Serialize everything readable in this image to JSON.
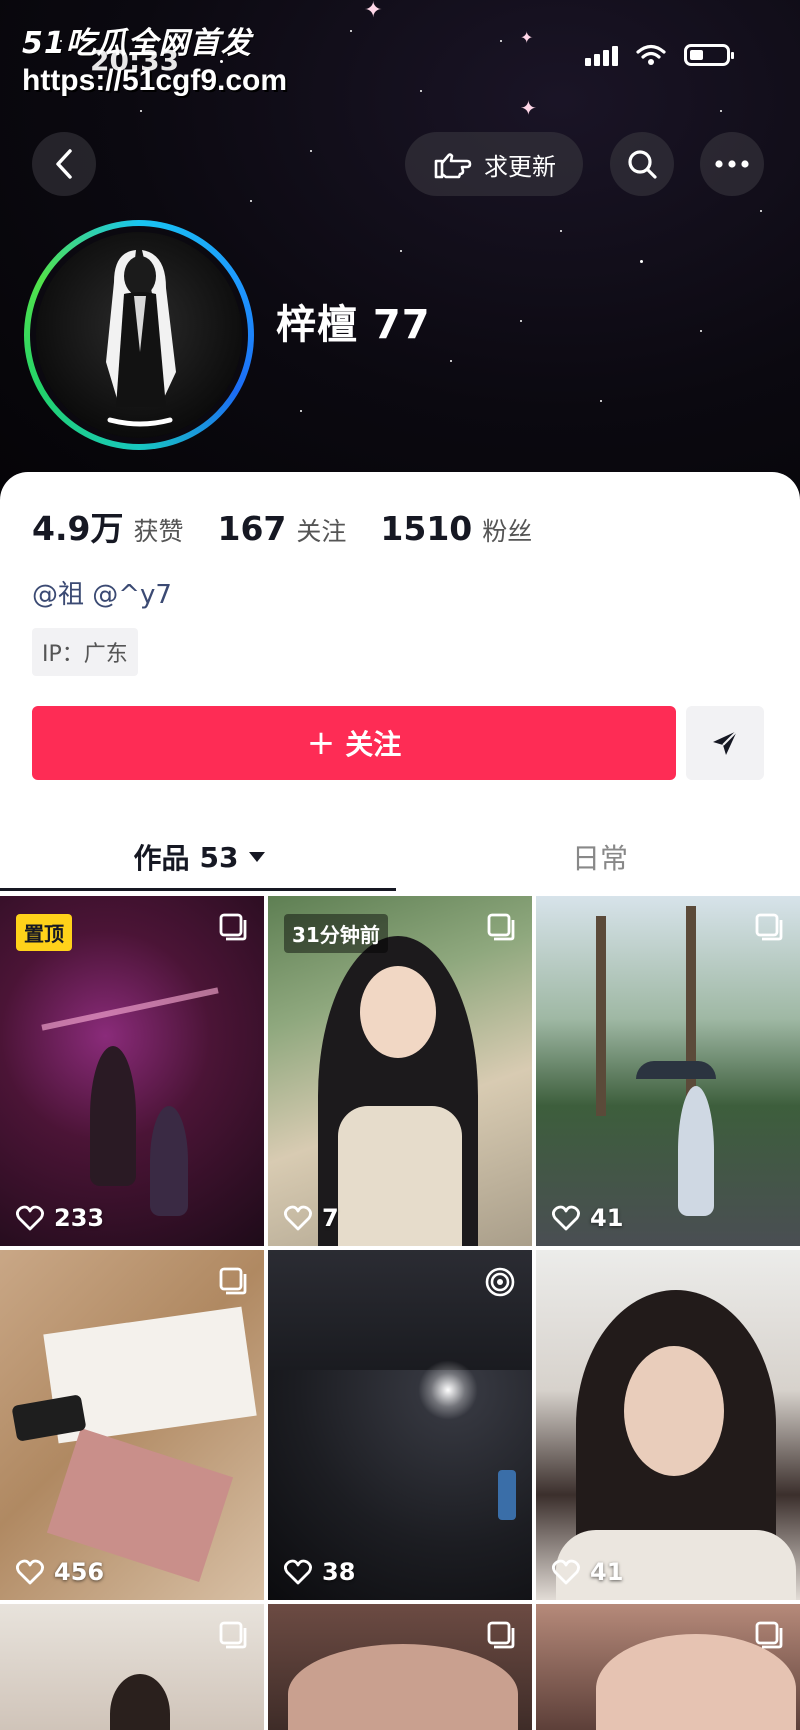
{
  "watermark": {
    "logo": "51吃瓜全网首发",
    "url": "https://51cgf9.com"
  },
  "status_bar": {
    "time": "20:33",
    "icons": [
      "signal-icon",
      "wifi-icon",
      "battery-icon"
    ]
  },
  "nav": {
    "back_icon": "chevron-left-icon",
    "update_label": "求更新",
    "update_icon": "pointing-hand-icon",
    "search_icon": "search-icon",
    "more_icon": "more-icon"
  },
  "profile": {
    "nickname": "梓檀 77",
    "stats": {
      "likes_value": "4.9万",
      "likes_label": "获赞",
      "following_value": "167",
      "following_label": "关注",
      "followers_value": "1510",
      "followers_label": "粉丝"
    },
    "handles": "@祖 @^y7",
    "ip": "IP：广东"
  },
  "actions": {
    "follow_label": "关注",
    "follow_plus": "+",
    "share_icon": "send-icon"
  },
  "tabs": [
    {
      "label": "作品",
      "count": "53",
      "active": true
    },
    {
      "label": "日常",
      "active": false
    }
  ],
  "videos": [
    {
      "likes": "233",
      "badge": "置顶",
      "corner_icon": "multi-image-icon"
    },
    {
      "likes": "7",
      "time_tag": "31分钟前",
      "corner_icon": "multi-image-icon"
    },
    {
      "likes": "41",
      "corner_icon": "multi-image-icon"
    },
    {
      "likes": "456",
      "corner_icon": "multi-image-icon"
    },
    {
      "likes": "38",
      "corner_icon": "live-photo-icon"
    },
    {
      "likes": "41"
    }
  ],
  "colors": {
    "follow": "#fe2c55",
    "pinned": "#ffd21a",
    "text": "#161823",
    "header_bg": "#0b0910"
  }
}
